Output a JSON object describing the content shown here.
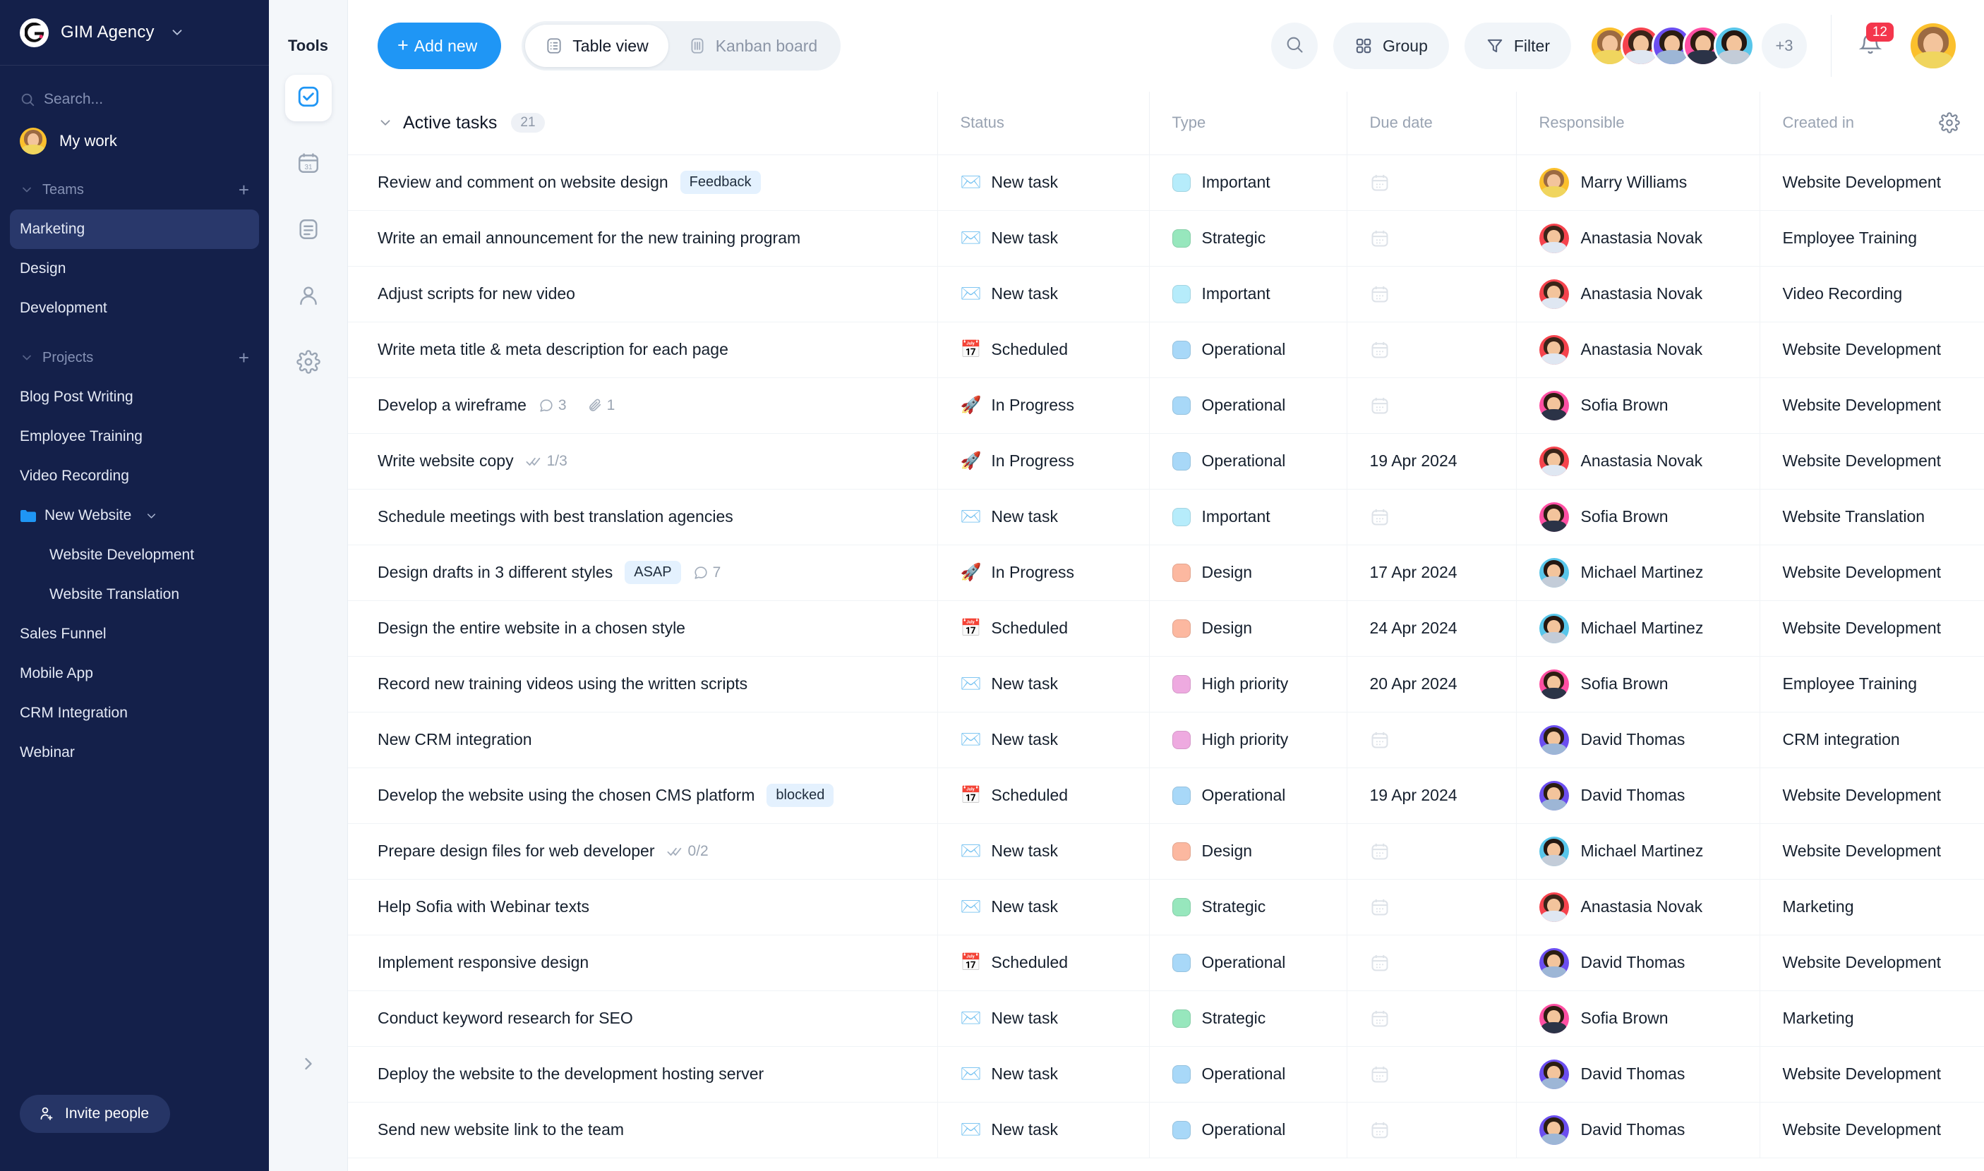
{
  "sidebar": {
    "brand": {
      "name": "GIM Agency",
      "caret_icon": "chevron-down-icon",
      "logo_icon": "gim-logo-icon"
    },
    "search": {
      "placeholder": "Search...",
      "icon": "search-icon"
    },
    "my_work": {
      "label": "My work"
    },
    "teams_section": {
      "title": "Teams",
      "add_label": "+",
      "chevron": "chevron-down-icon"
    },
    "teams": [
      {
        "label": "Marketing",
        "active": true
      },
      {
        "label": "Design",
        "active": false
      },
      {
        "label": "Development",
        "active": false
      }
    ],
    "projects_section": {
      "title": "Projects",
      "add_label": "+",
      "chevron": "chevron-down-icon"
    },
    "projects": [
      {
        "label": "Blog Post Writing",
        "type": "item"
      },
      {
        "label": "Employee Training",
        "type": "item"
      },
      {
        "label": "Video Recording",
        "type": "item"
      },
      {
        "label": "New Website",
        "type": "folder"
      },
      {
        "label": "Website Development",
        "type": "sub"
      },
      {
        "label": "Website Translation",
        "type": "sub"
      },
      {
        "label": "Sales Funnel",
        "type": "item"
      },
      {
        "label": "Mobile App",
        "type": "item"
      },
      {
        "label": "CRM Integration",
        "type": "item"
      },
      {
        "label": "Webinar",
        "type": "item"
      }
    ],
    "invite": {
      "label": "Invite people",
      "icon": "add-user-icon"
    }
  },
  "tools_rail": {
    "title": "Tools",
    "items": [
      {
        "icon": "checkbox-tasks-icon",
        "active": true
      },
      {
        "icon": "calendar-31-icon",
        "active": false
      },
      {
        "icon": "notes-document-icon",
        "active": false
      },
      {
        "icon": "person-contacts-icon",
        "active": false
      },
      {
        "icon": "gear-settings-icon",
        "active": false
      }
    ],
    "collapse_icon": "chevron-right-icon"
  },
  "topbar": {
    "add_new_label": "Add new",
    "add_new_plus": "+",
    "views": [
      {
        "label": "Table view",
        "icon": "table-view-icon",
        "active": true
      },
      {
        "label": "Kanban board",
        "icon": "kanban-board-icon",
        "active": false
      }
    ],
    "search_icon": "search-icon",
    "group_label": "Group",
    "group_icon": "grid-group-icon",
    "filter_label": "Filter",
    "filter_icon": "funnel-filter-icon",
    "avatar_overflow": "+3",
    "notification_count": "12",
    "notification_icon": "bell-icon",
    "accent_color": "#1f96f5",
    "badge_color": "#f4364c"
  },
  "table": {
    "group": {
      "label": "Active tasks",
      "count": "21",
      "chevron": "chevron-down-icon"
    },
    "columns": [
      "Active tasks",
      "Status",
      "Type",
      "Due date",
      "Responsible",
      "Created in"
    ],
    "settings_icon": "gear-icon",
    "type_colors": {
      "Important": "#b6ecfb",
      "Strategic": "#97e7bd",
      "Operational": "#a8d8f8",
      "Design": "#fcb8a0",
      "High priority": "#eeaae0"
    },
    "avatar_colors": {
      "Marry Williams": "#fbc02d",
      "Anastasia Novak": "#f5434d",
      "Sofia Brown": "#ff4fa3",
      "Michael Martinez": "#58c6ea",
      "David Thomas": "#6b4ef0"
    },
    "rows": [
      {
        "task": "Review and comment on website design",
        "tag": "Feedback",
        "comments": "",
        "attachments": "",
        "checklist": "",
        "status": "New task",
        "status_icon": "✉️",
        "type": "Important",
        "due": "",
        "responsible": "Marry Williams",
        "created": "Website Development"
      },
      {
        "task": "Write an email announcement for the new training program",
        "tag": "",
        "comments": "",
        "attachments": "",
        "checklist": "",
        "status": "New task",
        "status_icon": "✉️",
        "type": "Strategic",
        "due": "",
        "responsible": "Anastasia Novak",
        "created": "Employee Training"
      },
      {
        "task": "Adjust scripts for new video",
        "tag": "",
        "comments": "",
        "attachments": "",
        "checklist": "",
        "status": "New task",
        "status_icon": "✉️",
        "type": "Important",
        "due": "",
        "responsible": "Anastasia Novak",
        "created": "Video Recording"
      },
      {
        "task": "Write meta title & meta description for each page",
        "tag": "",
        "comments": "",
        "attachments": "",
        "checklist": "",
        "status": "Scheduled",
        "status_icon": "📅",
        "type": "Operational",
        "due": "",
        "responsible": "Anastasia Novak",
        "created": "Website Development"
      },
      {
        "task": "Develop a wireframe",
        "tag": "",
        "comments": "3",
        "attachments": "1",
        "checklist": "",
        "status": "In Progress",
        "status_icon": "🚀",
        "type": "Operational",
        "due": "",
        "responsible": "Sofia Brown",
        "created": "Website Development"
      },
      {
        "task": "Write website copy",
        "tag": "",
        "comments": "",
        "attachments": "",
        "checklist": "1/3",
        "status": "In Progress",
        "status_icon": "🚀",
        "type": "Operational",
        "due": "19 Apr 2024",
        "responsible": "Anastasia Novak",
        "created": "Website Development"
      },
      {
        "task": "Schedule meetings with best translation agencies",
        "tag": "",
        "comments": "",
        "attachments": "",
        "checklist": "",
        "status": "New task",
        "status_icon": "✉️",
        "type": "Important",
        "due": "",
        "responsible": "Sofia Brown",
        "created": "Website Translation"
      },
      {
        "task": "Design drafts in 3 different styles",
        "tag": "ASAP",
        "comments": "7",
        "attachments": "",
        "checklist": "",
        "status": "In Progress",
        "status_icon": "🚀",
        "type": "Design",
        "due": "17 Apr 2024",
        "responsible": "Michael Martinez",
        "created": "Website Development"
      },
      {
        "task": "Design the entire website in a chosen style",
        "tag": "",
        "comments": "",
        "attachments": "",
        "checklist": "",
        "status": "Scheduled",
        "status_icon": "📅",
        "type": "Design",
        "due": "24 Apr 2024",
        "responsible": "Michael Martinez",
        "created": "Website Development"
      },
      {
        "task": "Record new training videos using the written scripts",
        "tag": "",
        "comments": "",
        "attachments": "",
        "checklist": "",
        "status": "New task",
        "status_icon": "✉️",
        "type": "High priority",
        "due": "20 Apr 2024",
        "responsible": "Sofia Brown",
        "created": "Employee Training"
      },
      {
        "task": "New CRM integration",
        "tag": "",
        "comments": "",
        "attachments": "",
        "checklist": "",
        "status": "New task",
        "status_icon": "✉️",
        "type": "High priority",
        "due": "",
        "responsible": "David Thomas",
        "created": "CRM integration"
      },
      {
        "task": "Develop the website using the chosen CMS platform",
        "tag": "blocked",
        "comments": "",
        "attachments": "",
        "checklist": "",
        "status": "Scheduled",
        "status_icon": "📅",
        "type": "Operational",
        "due": "19 Apr 2024",
        "responsible": "David Thomas",
        "created": "Website Development"
      },
      {
        "task": "Prepare design files for web developer",
        "tag": "",
        "comments": "",
        "attachments": "",
        "checklist": "0/2",
        "status": "New task",
        "status_icon": "✉️",
        "type": "Design",
        "due": "",
        "responsible": "Michael Martinez",
        "created": "Website Development"
      },
      {
        "task": "Help Sofia with Webinar texts",
        "tag": "",
        "comments": "",
        "attachments": "",
        "checklist": "",
        "status": "New task",
        "status_icon": "✉️",
        "type": "Strategic",
        "due": "",
        "responsible": "Anastasia Novak",
        "created": "Marketing"
      },
      {
        "task": "Implement responsive design",
        "tag": "",
        "comments": "",
        "attachments": "",
        "checklist": "",
        "status": "Scheduled",
        "status_icon": "📅",
        "type": "Operational",
        "due": "",
        "responsible": "David Thomas",
        "created": "Website Development"
      },
      {
        "task": "Conduct keyword research for SEO",
        "tag": "",
        "comments": "",
        "attachments": "",
        "checklist": "",
        "status": "New task",
        "status_icon": "✉️",
        "type": "Strategic",
        "due": "",
        "responsible": "Sofia Brown",
        "created": "Marketing"
      },
      {
        "task": "Deploy the website to the development hosting server",
        "tag": "",
        "comments": "",
        "attachments": "",
        "checklist": "",
        "status": "New task",
        "status_icon": "✉️",
        "type": "Operational",
        "due": "",
        "responsible": "David Thomas",
        "created": "Website Development"
      },
      {
        "task": "Send new website link to the team",
        "tag": "",
        "comments": "",
        "attachments": "",
        "checklist": "",
        "status": "New task",
        "status_icon": "✉️",
        "type": "Operational",
        "due": "",
        "responsible": "David Thomas",
        "created": "Website Development"
      }
    ]
  }
}
